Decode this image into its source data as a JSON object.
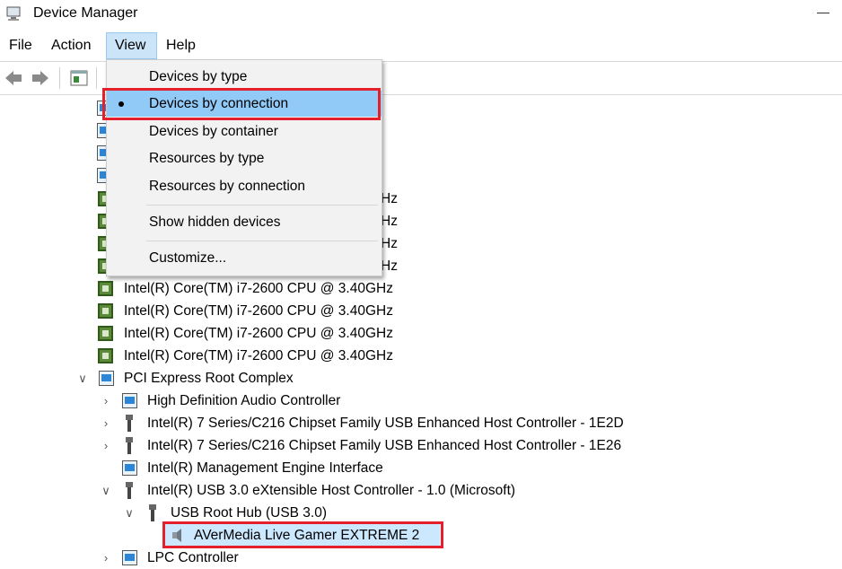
{
  "window": {
    "title": "Device Manager"
  },
  "menubar": {
    "file": "File",
    "action": "Action",
    "view": "View",
    "help": "Help"
  },
  "view_menu": {
    "items": [
      {
        "label": "Devices by type",
        "selected": false
      },
      {
        "label": "Devices by connection",
        "selected": true
      },
      {
        "label": "Devices by container",
        "selected": false
      },
      {
        "label": "Resources by type",
        "selected": false
      },
      {
        "label": "Resources by connection",
        "selected": false
      },
      {
        "label": "Show hidden devices",
        "selected": false
      },
      {
        "label": "Customize...",
        "selected": false
      }
    ],
    "partial_suffix": "Hz"
  },
  "tree": {
    "cpu_rows": [
      "Intel(R) Core(TM) i7-2600 CPU @ 3.40GHz",
      "Intel(R) Core(TM) i7-2600 CPU @ 3.40GHz",
      "Intel(R) Core(TM) i7-2600 CPU @ 3.40GHz",
      "Intel(R) Core(TM) i7-2600 CPU @ 3.40GHz"
    ],
    "pci_root": "PCI Express Root Complex",
    "children": [
      "High Definition Audio Controller",
      "Intel(R) 7 Series/C216 Chipset Family USB Enhanced Host Controller - 1E2D",
      "Intel(R) 7 Series/C216 Chipset Family USB Enhanced Host Controller - 1E26",
      "Intel(R) Management Engine Interface",
      "Intel(R) USB 3.0 eXtensible Host Controller - 1.0 (Microsoft)"
    ],
    "usb_root_hub": "USB Root Hub (USB 3.0)",
    "avermedia": "AVerMedia Live Gamer EXTREME 2",
    "lpc": "LPC Controller"
  },
  "colors": {
    "highlight_border": "#e3202c",
    "menu_selected": "#91c9f7",
    "tree_selected": "#cce8ff"
  }
}
